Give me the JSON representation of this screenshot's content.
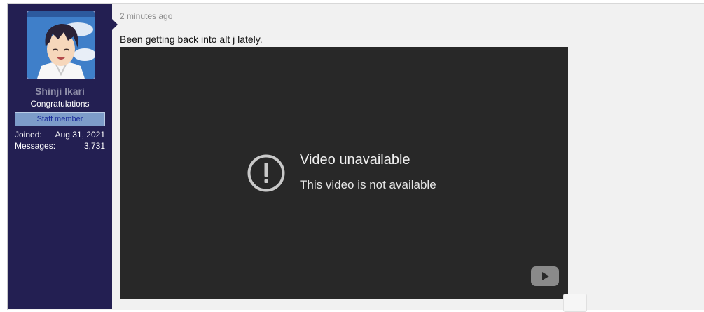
{
  "user": {
    "name": "Shinji Ikari",
    "title": "Congratulations",
    "badge": "Staff member",
    "stats": [
      {
        "label": "Joined:",
        "value": "Aug 31, 2021"
      },
      {
        "label": "Messages:",
        "value": "3,731"
      }
    ]
  },
  "post": {
    "timestamp": "2 minutes ago",
    "message": "Been getting back into alt j lately."
  },
  "video": {
    "title": "Video unavailable",
    "subtitle": "This video is not available",
    "icon": "exclamation-circle-icon",
    "logo": "youtube-logo-icon"
  },
  "colors": {
    "sidebar": "#231f52",
    "badge": "#7d9cc9",
    "video_bg": "#282828"
  }
}
